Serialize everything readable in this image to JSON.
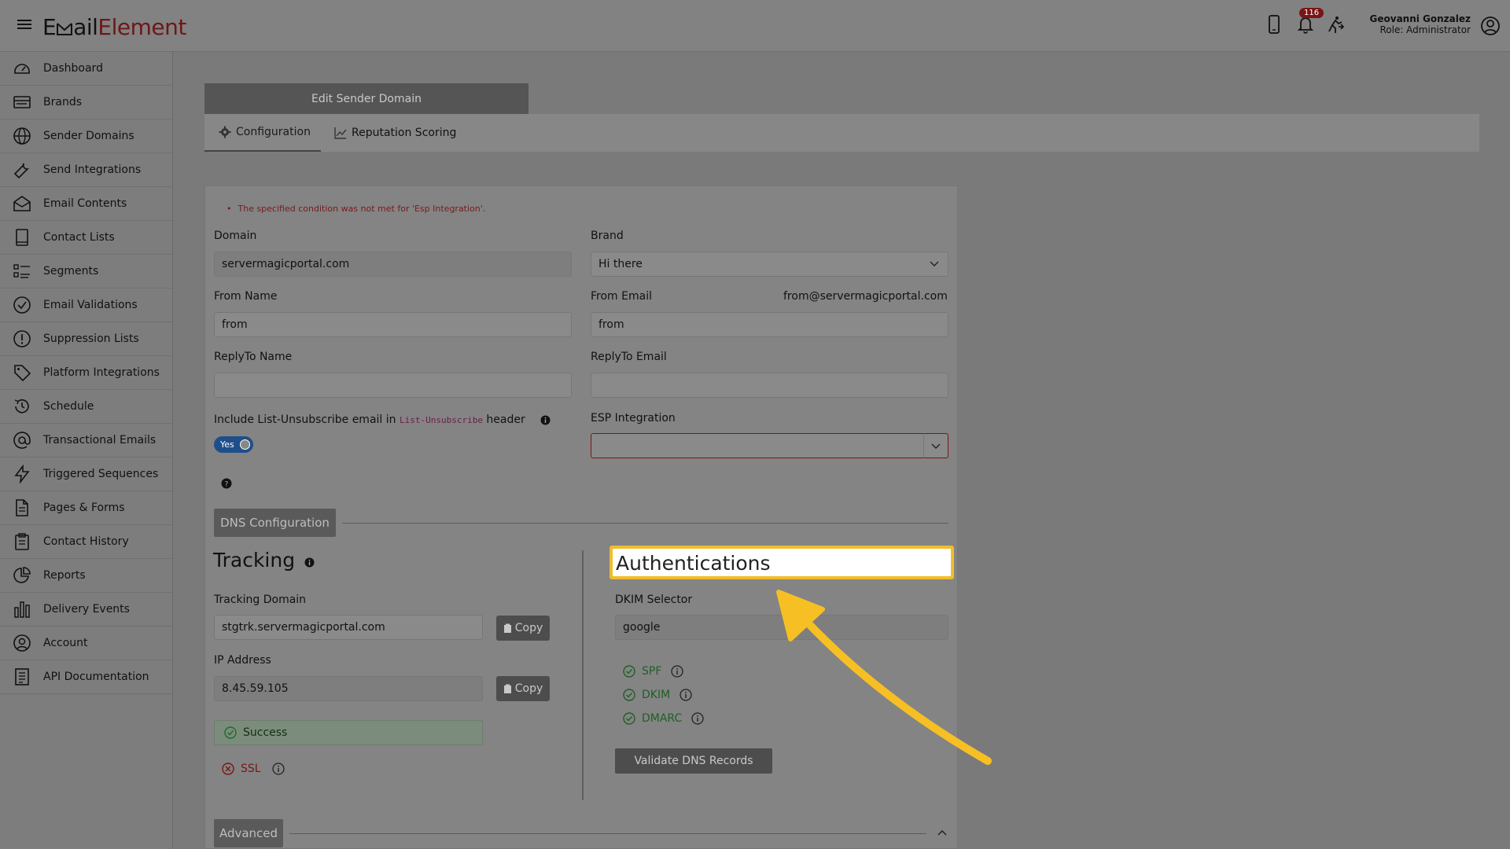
{
  "topbar": {
    "logo_pre": "E",
    "logo_mid": "ail",
    "logo_accent": "Element",
    "notifications_count": "116",
    "user_name": "Geovanni Gonzalez",
    "user_role": "Role: Administrator"
  },
  "sidebar": {
    "items": [
      {
        "label": "Dashboard",
        "icon": "dashboard-icon"
      },
      {
        "label": "Brands",
        "icon": "brands-icon"
      },
      {
        "label": "Sender Domains",
        "icon": "globe-icon"
      },
      {
        "label": "Send Integrations",
        "icon": "wrench-icon"
      },
      {
        "label": "Email Contents",
        "icon": "envelope-icon"
      },
      {
        "label": "Contact Lists",
        "icon": "book-icon"
      },
      {
        "label": "Segments",
        "icon": "list-icon"
      },
      {
        "label": "Email Validations",
        "icon": "check-circle-icon"
      },
      {
        "label": "Suppression Lists",
        "icon": "alert-circle-icon"
      },
      {
        "label": "Platform Integrations",
        "icon": "tag-icon"
      },
      {
        "label": "Schedule",
        "icon": "history-icon"
      },
      {
        "label": "Transactional Emails",
        "icon": "at-icon"
      },
      {
        "label": "Triggered Sequences",
        "icon": "bolt-icon"
      },
      {
        "label": "Pages & Forms",
        "icon": "file-icon"
      },
      {
        "label": "Contact History",
        "icon": "clipboard-icon"
      },
      {
        "label": "Reports",
        "icon": "pie-chart-icon"
      },
      {
        "label": "Delivery Events",
        "icon": "bar-chart-icon"
      },
      {
        "label": "Account",
        "icon": "user-circle-icon"
      },
      {
        "label": "API Documentation",
        "icon": "doc-icon"
      }
    ]
  },
  "page": {
    "title": "Edit Sender Domain",
    "tabs": [
      {
        "label": "Configuration",
        "active": true
      },
      {
        "label": "Reputation Scoring",
        "active": false
      }
    ]
  },
  "form": {
    "error": "The specified condition was not met for 'Esp Integration'.",
    "domain_label": "Domain",
    "domain_value": "servermagicportal.com",
    "brand_label": "Brand",
    "brand_value": "Hi there",
    "from_name_label": "From Name",
    "from_name_value": "from",
    "from_email_label": "From Email",
    "from_email_hint": "from@servermagicportal.com",
    "from_email_value": "from",
    "replyto_name_label": "ReplyTo Name",
    "replyto_name_value": "",
    "replyto_email_label": "ReplyTo Email",
    "replyto_email_value": "",
    "list_unsub_pre": "Include List-Unsubscribe email in",
    "list_unsub_code": "List-Unsubscribe",
    "list_unsub_post": "header",
    "toggle_label": "Yes",
    "esp_label": "ESP Integration",
    "esp_value": ""
  },
  "dns": {
    "section_label": "DNS Configuration",
    "tracking_title": "Tracking",
    "tracking_domain_label": "Tracking Domain",
    "tracking_domain_value": "stgtrk.servermagicportal.com",
    "copy_label": "Copy",
    "ip_label": "IP Address",
    "ip_value": "8.45.59.105",
    "success_label": "Success",
    "ssl_label": "SSL",
    "auth_title": "Authentications",
    "dkim_selector_label": "DKIM Selector",
    "dkim_selector_value": "google",
    "checks": [
      "SPF",
      "DKIM",
      "DMARC"
    ],
    "validate_label": "Validate DNS Records"
  },
  "advanced": {
    "label": "Advanced"
  },
  "colors": {
    "highlight": "#f0bd2a",
    "error": "#7a1515",
    "success": "#1f6b2a"
  }
}
